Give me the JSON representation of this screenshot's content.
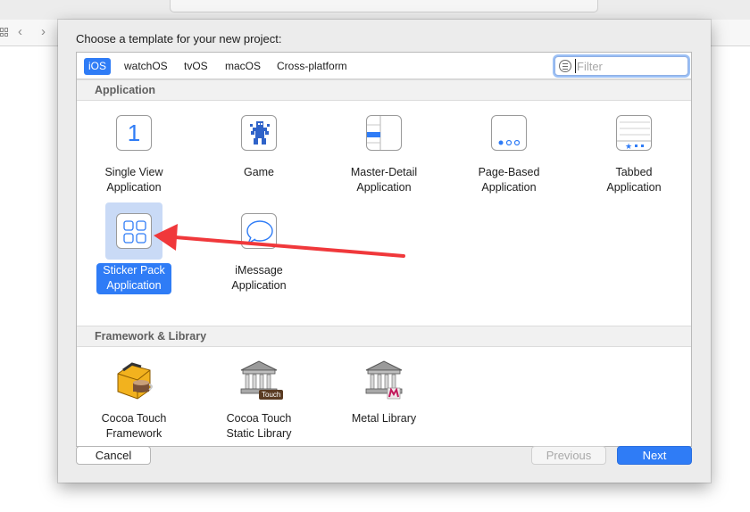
{
  "sheet": {
    "title": "Choose a template for your new project:"
  },
  "tabs": [
    "iOS",
    "watchOS",
    "tvOS",
    "macOS",
    "Cross-platform"
  ],
  "active_tab": "iOS",
  "filter": {
    "placeholder": "Filter",
    "value": ""
  },
  "sections": {
    "application": "Application",
    "framework": "Framework & Library"
  },
  "application_templates": [
    {
      "label": "Single View\nApplication",
      "icon": "single-view-icon"
    },
    {
      "label": "Game",
      "icon": "game-icon"
    },
    {
      "label": "Master-Detail\nApplication",
      "icon": "master-detail-icon"
    },
    {
      "label": "Page-Based\nApplication",
      "icon": "page-based-icon"
    },
    {
      "label": "Tabbed\nApplication",
      "icon": "tabbed-icon"
    },
    {
      "label": "Sticker Pack\nApplication",
      "icon": "sticker-pack-icon",
      "selected": true
    },
    {
      "label": "iMessage\nApplication",
      "icon": "imessage-icon"
    }
  ],
  "framework_templates": [
    {
      "label": "Cocoa Touch\nFramework",
      "icon": "toolbox-icon"
    },
    {
      "label": "Cocoa Touch\nStatic Library",
      "icon": "library-building-icon",
      "badge": "Touch"
    },
    {
      "label": "Metal Library",
      "icon": "metal-library-icon"
    }
  ],
  "single_view_glyph": "1",
  "buttons": {
    "cancel": "Cancel",
    "previous": "Previous",
    "next": "Next"
  },
  "colors": {
    "accent": "#2f7cf6",
    "annotation_arrow": "#f0383b"
  }
}
